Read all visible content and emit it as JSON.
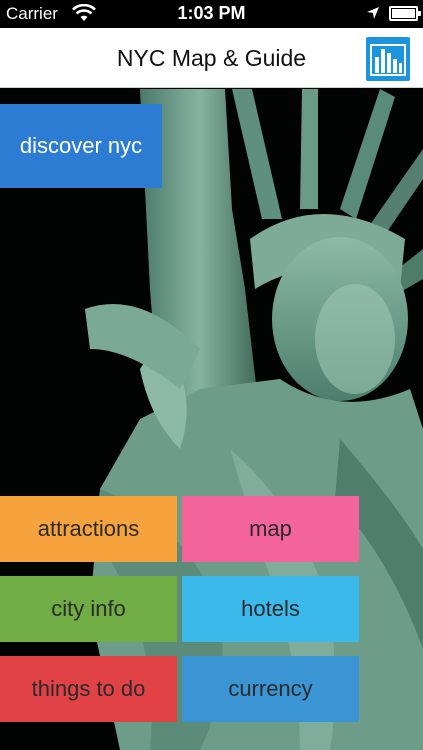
{
  "status_bar": {
    "carrier": "Carrier",
    "time": "1:03 PM"
  },
  "nav_bar": {
    "title": "NYC Map & Guide",
    "stats_button_icon": "bar-chart-icon"
  },
  "hero": {
    "background_color": "#020303",
    "statue_color": "#6f9e8c"
  },
  "tiles": {
    "discover": {
      "label": "discover nyc",
      "color": "#2c7cd4"
    },
    "attractions": {
      "label": "attractions",
      "color": "#f7a33d"
    },
    "map": {
      "label": "map",
      "color": "#f2649a"
    },
    "city_info": {
      "label": "city info",
      "color": "#70ad45"
    },
    "hotels": {
      "label": "hotels",
      "color": "#3bb9ea"
    },
    "things_to_do": {
      "label": "things to do",
      "color": "#e04246"
    },
    "currency": {
      "label": "currency",
      "color": "#3b94d3"
    }
  }
}
